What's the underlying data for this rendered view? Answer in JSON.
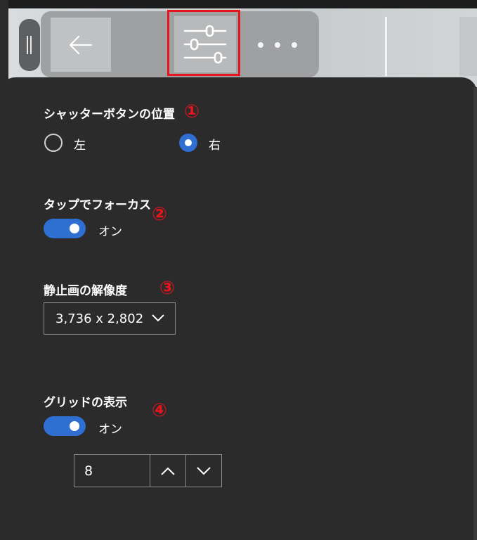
{
  "toolbar": {
    "back_icon": "arrow-left-icon",
    "settings_icon": "sliders-icon",
    "more_icon": "ellipsis-icon"
  },
  "colors": {
    "panel_bg": "#2b2b2b",
    "accent": "#2f6fd1",
    "annotation_red": "#e4151d"
  },
  "settings": {
    "shutter": {
      "title": "シャッターボタンの位置",
      "marker": "①",
      "options": [
        {
          "label": "左",
          "selected": false
        },
        {
          "label": "右",
          "selected": true
        }
      ]
    },
    "tap_focus": {
      "title": "タップでフォーカス",
      "marker": "②",
      "state_label": "オン",
      "on": true
    },
    "resolution": {
      "title": "静止画の解像度",
      "marker": "③",
      "value": "3,736 x 2,802"
    },
    "grid": {
      "title": "グリッドの表示",
      "marker": "④",
      "state_label": "オン",
      "on": true,
      "count": "8"
    }
  }
}
